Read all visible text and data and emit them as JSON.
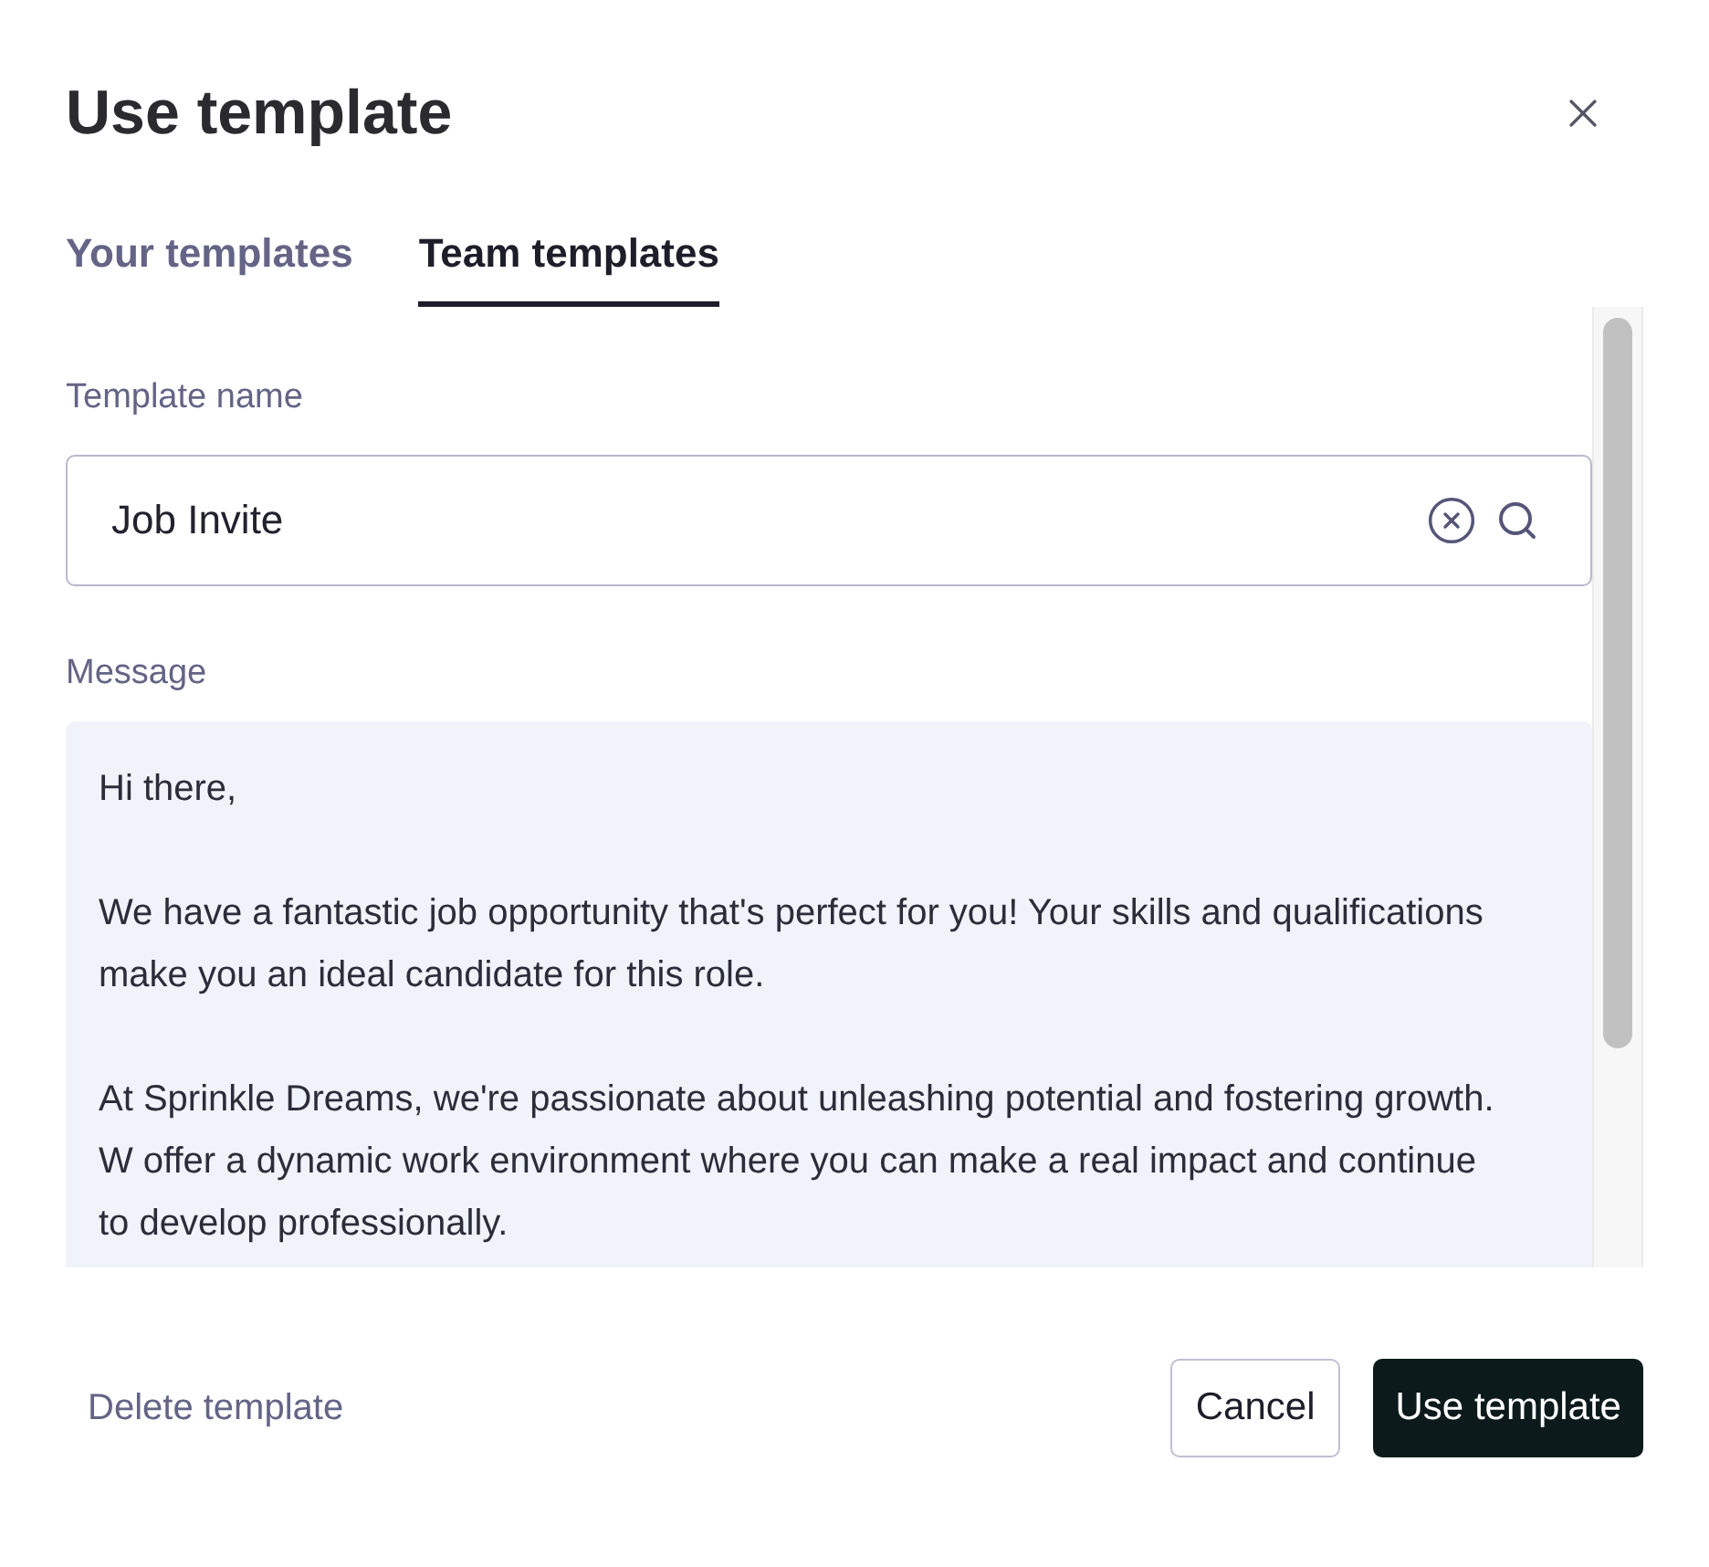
{
  "dialog": {
    "title": "Use template"
  },
  "tabs": [
    {
      "label": "Your templates",
      "selected": false
    },
    {
      "label": "Team templates",
      "selected": true
    }
  ],
  "template_name": {
    "label": "Template name",
    "value": "Job Invite"
  },
  "message": {
    "label": "Message",
    "paragraphs": [
      "Hi there,",
      "We have a fantastic job opportunity that's perfect for you! Your skills and qualifications make you an ideal candidate for this role.",
      "At Sprinkle Dreams, we're passionate about unleashing potential and fostering growth. W offer a dynamic work environment where you can make a real impact and continue to develop professionally."
    ]
  },
  "footer": {
    "delete_link": "Delete template",
    "cancel": "Cancel",
    "confirm": "Use template"
  }
}
